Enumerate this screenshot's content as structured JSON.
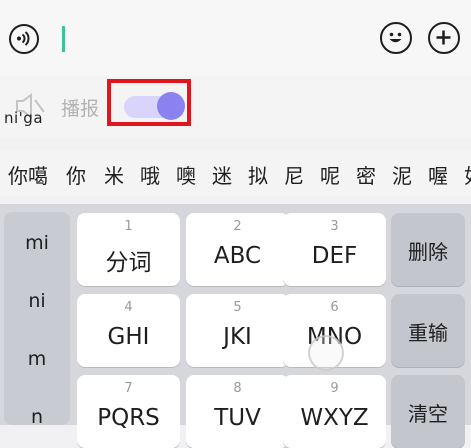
{
  "input_bar": {
    "voice_icon": "voice-input-icon",
    "emoji_icon": "emoji-icon",
    "add_icon": "plus-icon"
  },
  "broadcast": {
    "pinyin": "ni'ga",
    "label": "播报",
    "speaker_icon": "speaker-muted-icon",
    "toggle_on": true,
    "toggle_color": "#8a82ee",
    "highlight_color": "#e0151e"
  },
  "candidates": [
    "你噶",
    "你",
    "米",
    "哦",
    "噢",
    "迷",
    "拟",
    "尼",
    "呢",
    "密",
    "泥",
    "喔",
    "如"
  ],
  "keyboard": {
    "left_column": [
      "mi",
      "ni",
      "m",
      "n"
    ],
    "keys": [
      {
        "num": "1",
        "label": "分词"
      },
      {
        "num": "2",
        "label": "ABC"
      },
      {
        "num": "3",
        "label": "DEF"
      },
      {
        "num": "4",
        "label": "GHI"
      },
      {
        "num": "5",
        "label": "JKI"
      },
      {
        "num": "6",
        "label": "MNO"
      },
      {
        "num": "7",
        "label": "PQRS"
      },
      {
        "num": "8",
        "label": "TUV"
      },
      {
        "num": "9",
        "label": "WXYZ"
      }
    ],
    "function_keys": [
      "删除",
      "重输",
      "清空"
    ]
  }
}
